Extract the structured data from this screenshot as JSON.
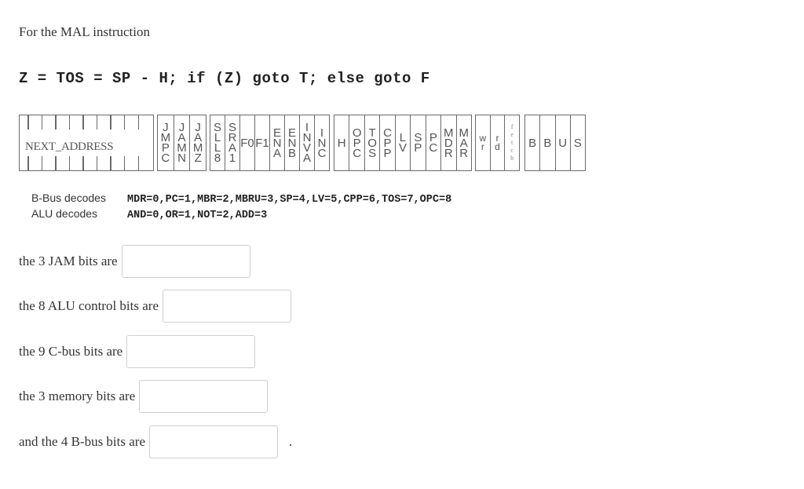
{
  "intro": "For the MAL instruction",
  "mal_instruction": "Z = TOS = SP - H; if (Z) goto T; else goto F",
  "microinstruction_format": {
    "next_address_label": "NEXT_ADDRESS",
    "jam_fields": [
      "JMPC",
      "JAMN",
      "JAMZ"
    ],
    "alu_fields": [
      "SLL8",
      "SRA1",
      "F0",
      "F1",
      "ENA",
      "ENB",
      "INVA",
      "INC"
    ],
    "cbus_fields": [
      "H",
      "OPC",
      "TOS",
      "CPP",
      "LV",
      "SP",
      "PC",
      "MDR",
      "MAR"
    ],
    "memory_fields": [
      "wr",
      "rd",
      "fetch"
    ],
    "bbus_fields": [
      "B",
      "B",
      "U",
      "S"
    ]
  },
  "decodes": {
    "bbus_label": "B-Bus decodes",
    "bbus_value": "MDR=0,PC=1,MBR=2,MBRU=3,SP=4,LV=5,CPP=6,TOS=7,OPC=8",
    "alu_label": "ALU decodes",
    "alu_value": "AND=0,OR=1,NOT=2,ADD=3"
  },
  "questions": [
    {
      "label": "the 3 JAM bits are",
      "value": ""
    },
    {
      "label": "the 8 ALU control bits are",
      "value": ""
    },
    {
      "label": "the 9 C-bus bits are",
      "value": ""
    },
    {
      "label": "the 3 memory bits are",
      "value": ""
    },
    {
      "label": "and the 4 B-bus bits are",
      "value": "",
      "suffix": "."
    }
  ]
}
